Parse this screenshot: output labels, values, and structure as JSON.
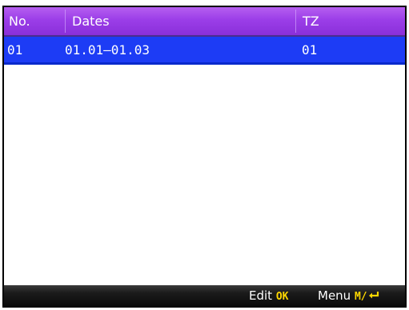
{
  "table": {
    "columns": {
      "no": "No.",
      "dates": "Dates",
      "tz": "TZ"
    },
    "rows": [
      {
        "no": "01",
        "dates": "01.01—01.03",
        "tz": "01",
        "selected": true
      }
    ]
  },
  "footer": {
    "edit_label": "Edit",
    "edit_key": "OK",
    "menu_label": "Menu",
    "menu_key": "M/",
    "menu_key_icon": "enter-icon"
  },
  "colors": {
    "header": "#9b3ee8",
    "selected_row": "#1d3cf5",
    "footer": "#111111",
    "key_text": "#ffd800"
  }
}
